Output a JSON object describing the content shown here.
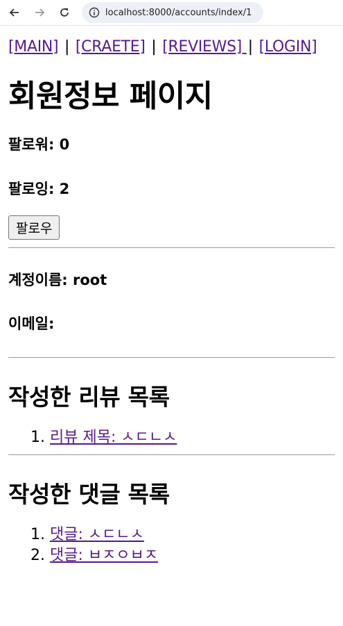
{
  "browser": {
    "url": "localhost:8000/accounts/index/1"
  },
  "nav": {
    "main": "[MAIN]",
    "create": "[CRAETE]",
    "reviews": "[REVIEWS] ",
    "login": "[LOGIN]",
    "separator": "|"
  },
  "page_title": "회원정보 페이지",
  "stats": {
    "followers": "팔로워: 0",
    "following": "팔로잉: 2"
  },
  "follow_button": "팔로우",
  "account": {
    "username": "계정이름: root",
    "email": "이메일:"
  },
  "reviews_section": {
    "title": "작성한 리뷰 목록",
    "items": [
      "리뷰 제목: ㅅㄷㄴㅅ"
    ]
  },
  "comments_section": {
    "title": "작성한 댓글 목록",
    "items": [
      "댓글: ㅅㄷㄴㅅ",
      "댓글: ㅂㅈㅇㅂㅈ"
    ]
  }
}
